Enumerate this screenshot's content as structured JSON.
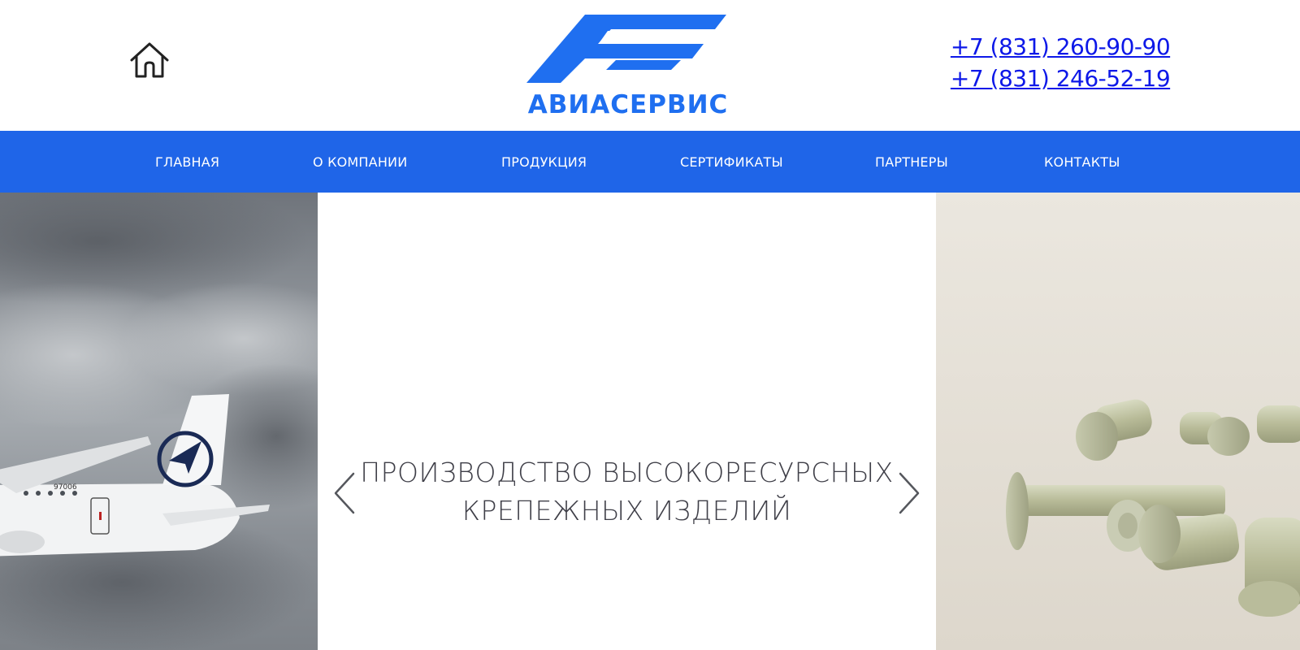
{
  "header": {
    "home_icon": "home-icon",
    "logo": {
      "text": "АВИАСЕРВИС",
      "color": "#1f6ff0"
    },
    "phones": [
      "+7 (831) 260-90-90",
      "+7 (831) 246-52-19"
    ],
    "phone_color": "#0d18e8"
  },
  "nav": {
    "background": "#1f65e8",
    "items": [
      {
        "label": "ГЛАВНАЯ"
      },
      {
        "label": "О КОМПАНИИ"
      },
      {
        "label": "ПРОДУКЦИЯ"
      },
      {
        "label": "СЕРТИФИКАТЫ"
      },
      {
        "label": "ПАРТНЕРЫ"
      },
      {
        "label": "КОНТАКТЫ"
      }
    ]
  },
  "hero": {
    "title_line1": "ПРОИЗВОДСТВО ВЫСОКОРЕСУРСНЫХ",
    "title_line2": "КРЕПЕЖНЫХ ИЗДЕЛИЙ",
    "prev_icon": "chevron-left-icon",
    "next_icon": "chevron-right-icon",
    "left_image": "airplane-photo",
    "right_image": "rivets-photo",
    "aircraft_registration": "97006"
  }
}
